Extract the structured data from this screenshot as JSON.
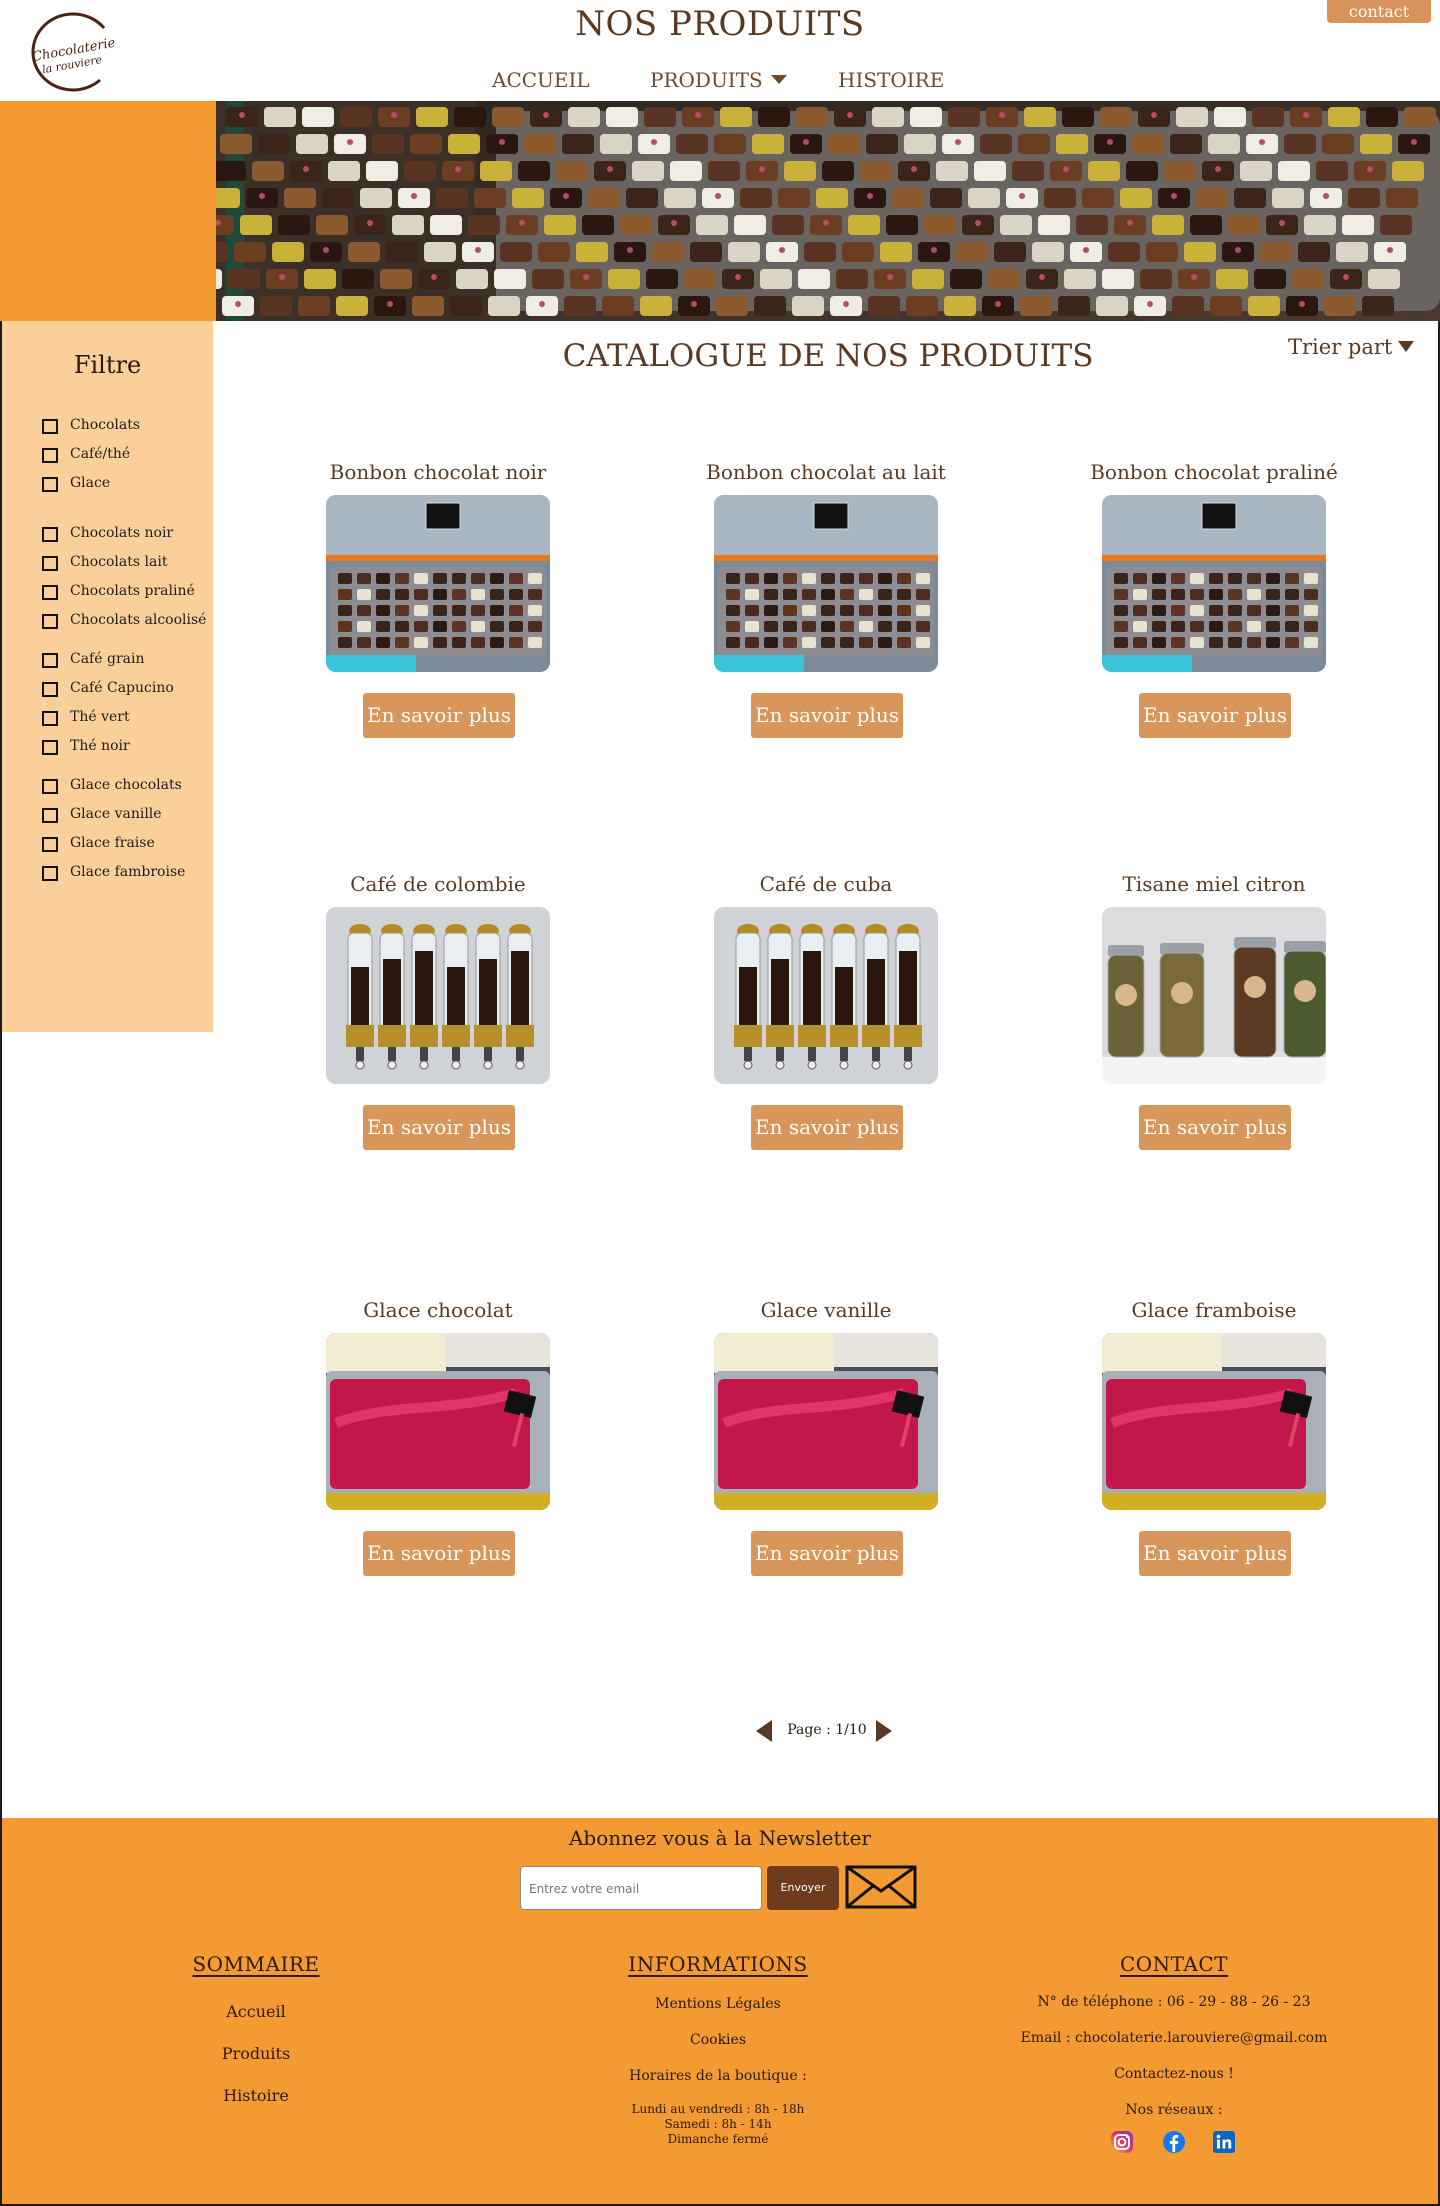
{
  "header": {
    "title": "NOS PRODUITS",
    "contact_label": "contact",
    "logo_line1": "Chocolaterie",
    "logo_line2": "la rouviere",
    "nav": [
      {
        "label": "ACCUEIL"
      },
      {
        "label": "PRODUITS"
      },
      {
        "label": "HISTOIRE"
      }
    ]
  },
  "sidebar": {
    "title": "Filtre",
    "groups": [
      [
        "Chocolats",
        "Café/thé",
        "Glace"
      ],
      [
        "Chocolats noir",
        "Chocolats lait",
        "Chocolats praliné",
        "Chocolats alcoolisé"
      ],
      [
        "Café grain",
        "Café Capucino",
        "Thé vert",
        "Thé noir"
      ],
      [
        "Glace chocolats",
        "Glace vanille",
        "Glace fraise",
        "Glace fambroise"
      ]
    ]
  },
  "catalogue": {
    "title": "CATALOGUE DE NOS PRODUITS",
    "sort_label": "Trier part",
    "button_label": "En savoir plus",
    "products": [
      {
        "name": "Bonbon chocolat noir",
        "image": "chocolate-display"
      },
      {
        "name": "Bonbon chocolat au lait",
        "image": "chocolate-display"
      },
      {
        "name": "Bonbon chocolat praliné",
        "image": "chocolate-display"
      },
      {
        "name": "Café de colombie",
        "image": "coffee-dispensers"
      },
      {
        "name": "Café de cuba",
        "image": "coffee-dispensers"
      },
      {
        "name": "Tisane miel citron",
        "image": "tea-jars"
      },
      {
        "name": "Glace chocolat",
        "image": "ice-cream-tub"
      },
      {
        "name": "Glace vanille",
        "image": "ice-cream-tub"
      },
      {
        "name": "Glace framboise",
        "image": "ice-cream-tub"
      }
    ],
    "pagination": "Page : 1/10"
  },
  "footer": {
    "newsletter_title": "Abonnez vous à la Newsletter",
    "email_placeholder": "Entrez votre email",
    "send_label": "Envoyer",
    "sommaire": {
      "heading": "SOMMAIRE",
      "links": [
        "Accueil",
        "Produits",
        "Histoire"
      ]
    },
    "informations": {
      "heading": "INFORMATIONS",
      "links": [
        "Mentions Légales",
        "Cookies",
        "Horaires de la boutique :"
      ],
      "hours": [
        "Lundi au vendredi : 8h - 18h",
        "Samedi : 8h - 14h",
        "Dimanche fermé"
      ]
    },
    "contact": {
      "heading": "CONTACT",
      "phone": "N° de téléphone : 06 - 29 - 88 - 26 - 23",
      "email": "Email : chocolaterie.larouviere@gmail.com",
      "cta": "Contactez-nous !",
      "networks_label": "Nos réseaux :",
      "networks": [
        "instagram-icon",
        "facebook-icon",
        "linkedin-icon"
      ]
    }
  },
  "colors": {
    "orange": "#f39a33",
    "light_orange": "#fbcf9a",
    "button": "#d8965a",
    "brown": "#5a3a22"
  }
}
